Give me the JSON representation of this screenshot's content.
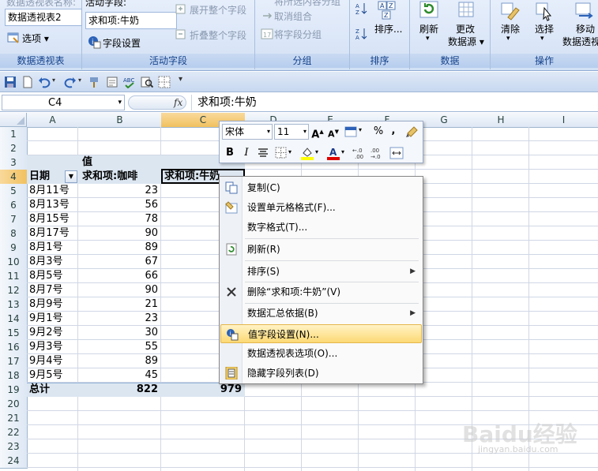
{
  "ribbon": {
    "pivot_name_label": "数据透视表名称:",
    "pivot_name_value": "数据透视表2",
    "options_label": "选项",
    "group_pivot_label": "数据透视表",
    "active_field_label": "活动字段:",
    "active_field_value": "求和项:牛奶",
    "field_settings_label": "字段设置",
    "expand_label": "展开整个字段",
    "collapse_label": "折叠整个字段",
    "group_active_label": "活动字段",
    "group_selection_label": "将所选内容分组",
    "ungroup_label": "取消组合",
    "group_field_label": "将字段分组",
    "group_group_label": "分组",
    "sort_label": "排序...",
    "group_sort_label": "排序",
    "refresh_label": "刷新",
    "change_source_label1": "更改",
    "change_source_label2": "数据源",
    "group_data_label": "数据",
    "clear_label": "清除",
    "select_label": "选择",
    "move_label1": "移动",
    "move_label2": "数据透视",
    "group_actions_label": "操作"
  },
  "formula_bar": {
    "name_box": "C4",
    "fx": "fx",
    "formula": "求和项:牛奶"
  },
  "sheet": {
    "columns": [
      "A",
      "B",
      "C",
      "D",
      "E",
      "F",
      "G",
      "H",
      "I"
    ],
    "rows": [
      "1",
      "2",
      "3",
      "4",
      "5",
      "6",
      "7",
      "8",
      "9",
      "10",
      "11",
      "12",
      "13",
      "14",
      "15",
      "16",
      "17",
      "18",
      "19",
      "20",
      "21",
      "22",
      "23",
      "24"
    ],
    "values_header": "值",
    "date_header": "日期",
    "coffee_header": "求和项:咖啡",
    "milk_header": "求和项:牛奶",
    "data": [
      {
        "date": "8月11号",
        "coffee": "23"
      },
      {
        "date": "8月13号",
        "coffee": "56"
      },
      {
        "date": "8月15号",
        "coffee": "78"
      },
      {
        "date": "8月17号",
        "coffee": "90"
      },
      {
        "date": "8月1号",
        "coffee": "89"
      },
      {
        "date": "8月3号",
        "coffee": "67"
      },
      {
        "date": "8月5号",
        "coffee": "66"
      },
      {
        "date": "8月7号",
        "coffee": "90"
      },
      {
        "date": "8月9号",
        "coffee": "21"
      },
      {
        "date": "9月1号",
        "coffee": "23"
      },
      {
        "date": "9月2号",
        "coffee": "30"
      },
      {
        "date": "9月3号",
        "coffee": "55"
      },
      {
        "date": "9月4号",
        "coffee": "89"
      },
      {
        "date": "9月5号",
        "coffee": "45"
      }
    ],
    "total_label": "总计",
    "total_coffee": "822",
    "total_milk": "979"
  },
  "mini_toolbar": {
    "font": "宋体",
    "size": "11",
    "percent": "%",
    "comma": ","
  },
  "context_menu": {
    "copy": "复制(C)",
    "format_cells": "设置单元格格式(F)...",
    "number_format": "数字格式(T)...",
    "refresh": "刷新(R)",
    "sort": "排序(S)",
    "delete": "删除“求和项:牛奶”(V)",
    "summarize": "数据汇总依据(B)",
    "value_field_settings": "值字段设置(N)...",
    "pivot_options": "数据透视表选项(O)...",
    "hide_field_list": "隐藏字段列表(D)"
  },
  "watermark": {
    "text": "Baidu经验",
    "url_text": "jingyan.baidu.com"
  }
}
